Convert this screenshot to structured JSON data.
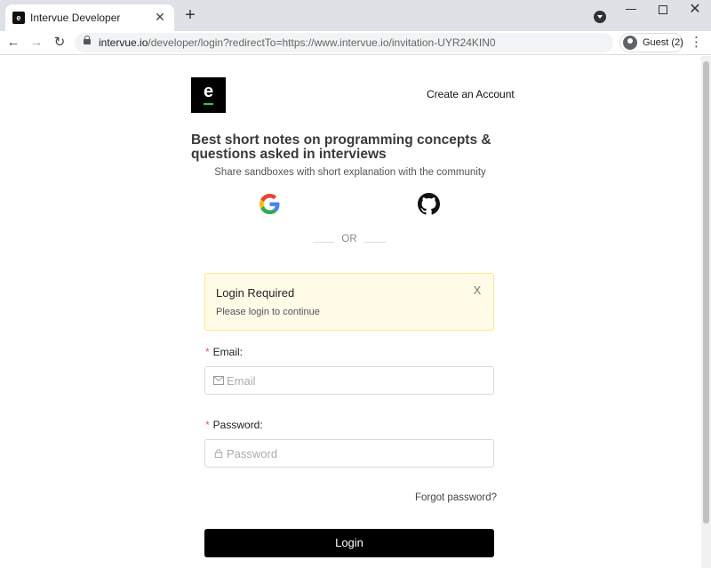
{
  "browser": {
    "tab_title": "Intervue Developer",
    "tab_close": "✕",
    "new_tab": "+",
    "url_host": "intervue.io",
    "url_rest": "/developer/login?redirectTo=https://www.intervue.io/invitation-UYR24KIN0",
    "profile_label": "Guest (2)",
    "nav": {
      "back": "←",
      "forward": "→",
      "reload": "↻"
    },
    "menu": "⋮",
    "win_close": "✕"
  },
  "header": {
    "logo_letter": "e",
    "create_account": "Create an Account"
  },
  "hero": {
    "headline": "Best short notes on programming concepts & questions asked in interviews",
    "subline": "Share sandboxes with short explanation with the community"
  },
  "social": {
    "separator": "OR",
    "google_icon": "google-icon",
    "github_icon": "github-icon"
  },
  "alert": {
    "title": "Login Required",
    "description": "Please login to continue",
    "close": "X"
  },
  "form": {
    "required_mark": "*",
    "email_label": "Email:",
    "email_placeholder": "Email",
    "email_value": "",
    "password_label": "Password:",
    "password_placeholder": "Password",
    "password_value": "",
    "forgot_password": "Forgot password?",
    "login_button": "Login"
  },
  "colors": {
    "brand": "#000000",
    "brand_accent": "#2ecc40",
    "alert_bg": "#fffbe6",
    "alert_border": "#ffe58f",
    "required": "#ff4d4f"
  }
}
